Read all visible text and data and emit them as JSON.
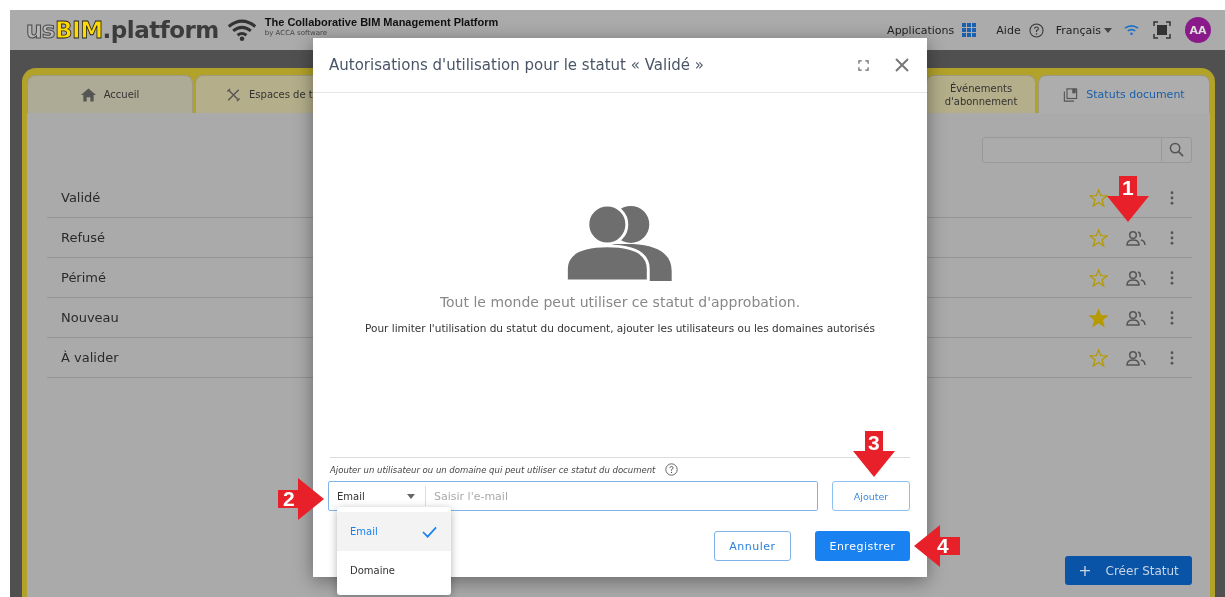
{
  "header": {
    "logo": {
      "prefix": "us",
      "brand": "BIM",
      "suffix": ".platform"
    },
    "tagline": "The Collaborative BIM Management Platform",
    "byline": "by ACCA software",
    "applications": "Applications",
    "help": "Aide",
    "language": "Français",
    "avatar": "AA"
  },
  "tabs": [
    {
      "label": "Accueil",
      "selected": false
    },
    {
      "label": "Espaces de t",
      "selected": false
    },
    {
      "label": "Événements d'abonnement",
      "selected": false
    },
    {
      "label": "Statuts document",
      "selected": true
    }
  ],
  "statuses": [
    {
      "name": "Validé",
      "favorite": false
    },
    {
      "name": "Refusé",
      "favorite": false
    },
    {
      "name": "Périmé",
      "favorite": false
    },
    {
      "name": "Nouveau",
      "favorite": true
    },
    {
      "name": "À valider",
      "favorite": false
    }
  ],
  "create_button": {
    "icon": "+",
    "label": "Créer Statut"
  },
  "dialog": {
    "title": "Autorisations d'utilisation pour le statut « Validé »",
    "message": "Tout le monde peut utiliser ce statut d'approbation.",
    "hint": "Pour limiter l'utilisation du statut du document, ajouter les utilisateurs ou les domaines autorisés",
    "field_label": "Ajouter un utilisateur ou un domaine qui peut utiliser ce statut du document",
    "type_select": "Email",
    "input": {
      "placeholder": "Saisir l'e-mail"
    },
    "add_button": "Ajouter",
    "cancel_button": "Annuler",
    "save_button": "Enregistrer",
    "type_options": [
      {
        "label": "Email",
        "selected": true
      },
      {
        "label": "Domaine",
        "selected": false
      }
    ]
  },
  "annotations": [
    {
      "label": "1"
    },
    {
      "label": "2"
    },
    {
      "label": "3"
    },
    {
      "label": "4"
    }
  ]
}
